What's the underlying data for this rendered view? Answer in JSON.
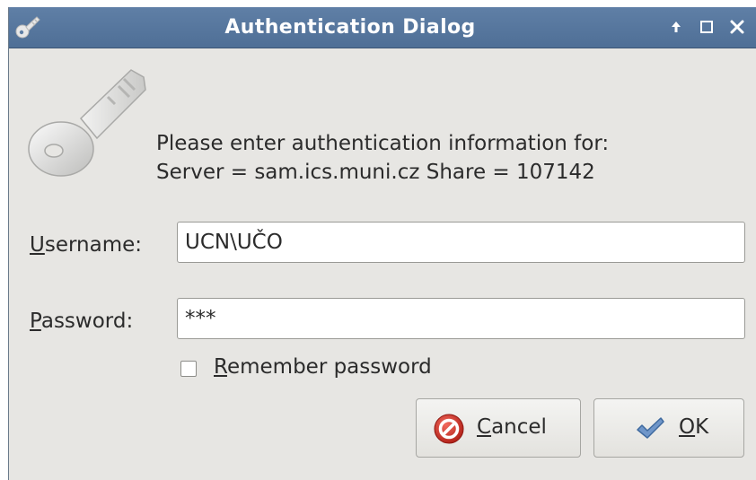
{
  "window": {
    "title": "Authentication Dialog",
    "controls": {
      "minimize_icon": "up-arrow-icon",
      "maximize_icon": "square-icon",
      "close_icon": "close-icon"
    }
  },
  "message": {
    "line1": "Please enter authentication information for:",
    "line2": "Server = sam.ics.muni.cz Share = 107142"
  },
  "form": {
    "username": {
      "label_mnemonic": "U",
      "label_rest": "sername:",
      "value": "UCN\\UČO"
    },
    "password": {
      "label_mnemonic": "P",
      "label_rest": "assword:",
      "value": "***"
    },
    "remember": {
      "label_mnemonic": "R",
      "label_rest": "emember password",
      "checked": false
    }
  },
  "buttons": {
    "cancel": {
      "mnemonic": "C",
      "rest": "ancel",
      "icon": "cancel-icon"
    },
    "ok": {
      "mnemonic": "O",
      "rest": "K",
      "icon": "checkmark-icon"
    }
  },
  "colors": {
    "titlebar": "#5778a0",
    "dialog_bg": "#e7e6e3",
    "cancel_red": "#d8342a",
    "ok_blue": "#5b86bd"
  }
}
